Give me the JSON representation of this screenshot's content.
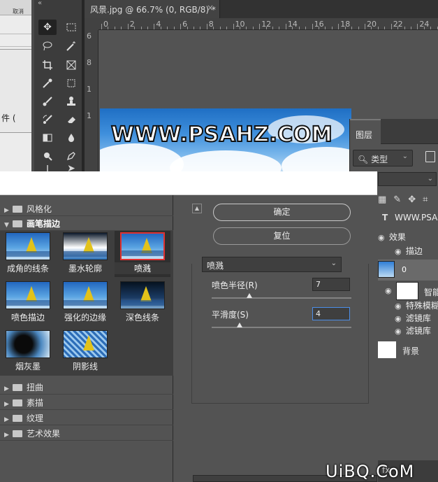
{
  "left_strip": {
    "top_text": "取消",
    "file_text": "件 ("
  },
  "document_tab": {
    "title": "风景.jpg @ 66.7% (0, RGB/8) *",
    "close": "×"
  },
  "ruler": {
    "top": [
      "0",
      "2",
      "4",
      "6",
      "8",
      "10",
      "12",
      "14",
      "16",
      "18",
      "20",
      "22",
      "24"
    ],
    "left": [
      "6",
      "8",
      "1",
      "1"
    ]
  },
  "photo": {
    "text": "WWW.PSAHZ.COM"
  },
  "layers_panel": {
    "tab": "图层",
    "kind_filter": "类型",
    "layers": {
      "text_layer": "WWW.PSA",
      "effects": "效果",
      "stroke": "描边",
      "zero_layer": "0",
      "smart": "智能",
      "special_blur": "特殊模糊",
      "filter_library_1": "滤镜库",
      "filter_library_2": "滤镜库",
      "background": "背景"
    },
    "footer": "fx"
  },
  "filter_gallery": {
    "categories": {
      "stylize": "风格化",
      "brush_strokes": "画笔描边",
      "distort": "扭曲",
      "sketch": "素描",
      "texture": "纹理",
      "artistic": "艺术效果"
    },
    "thumbnails": [
      "成角的线条",
      "墨水轮廓",
      "喷溅",
      "喷色描边",
      "强化的边缘",
      "深色线条",
      "烟灰墨",
      "阴影线"
    ],
    "selected_filter": "喷溅",
    "ok": "确定",
    "reset": "复位",
    "params": {
      "radius_label": "喷色半径(R)",
      "radius_value": "7",
      "smooth_label": "平滑度(S)",
      "smooth_value": "4"
    },
    "colors": {
      "selection_border": "#e03131"
    }
  },
  "watermark": "UiBQ.CoM"
}
